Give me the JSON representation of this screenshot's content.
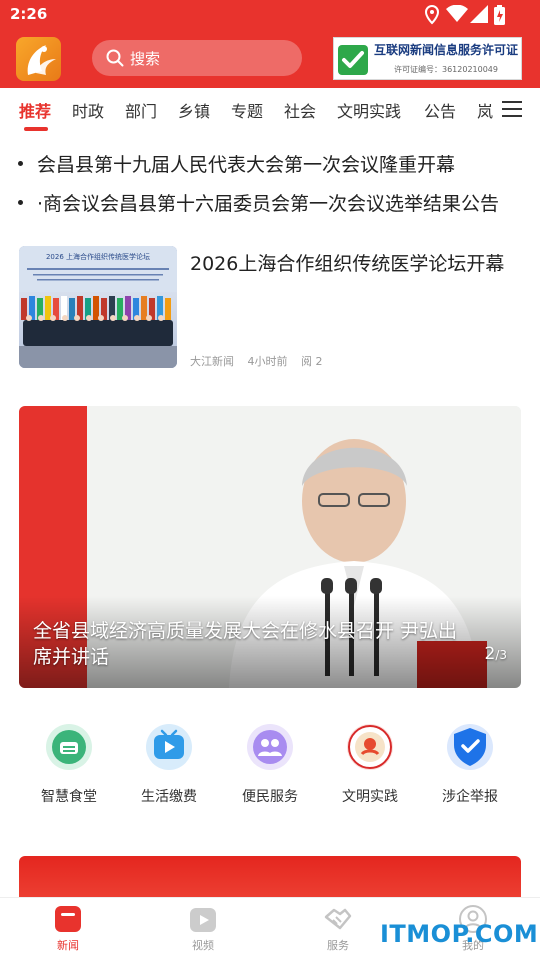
{
  "status_bar": {
    "time": "2:26"
  },
  "header": {
    "search_placeholder": "搜索",
    "license": {
      "title": "互联网新闻信息服务许可证",
      "code": "许可证编号：36120210049"
    }
  },
  "tabs": [
    {
      "label": "推荐",
      "active": true
    },
    {
      "label": "时政"
    },
    {
      "label": "部门"
    },
    {
      "label": "乡镇"
    },
    {
      "label": "专题"
    },
    {
      "label": "社会"
    },
    {
      "label": "文明实践"
    },
    {
      "label": "公告"
    },
    {
      "label": "岚"
    }
  ],
  "headlines": [
    "会昌县第十九届人民代表大会第一次会议隆重开幕",
    "·商会议会昌县第十六届委员会第一次会议选举结果公告"
  ],
  "news_item": {
    "title": "2026上海合作组织传统医学论坛开幕",
    "source": "大江新闻",
    "time": "4小时前",
    "reads": "阅 2",
    "thumb_banner_text": "2026 上海合作组织传统医学论坛"
  },
  "banner": {
    "caption": "全省县域经济高质量发展大会在修水县召开 尹弘出席并讲话",
    "page_current": "2",
    "page_total": "/3"
  },
  "services": [
    {
      "label": "智慧食堂",
      "icon": "canteen-icon",
      "color": "#3bb47a"
    },
    {
      "label": "生活缴费",
      "icon": "tv-payment-icon",
      "color": "#2f9be8"
    },
    {
      "label": "便民服务",
      "icon": "people-service-icon",
      "color": "#8e6ee0"
    },
    {
      "label": "文明实践",
      "icon": "civilization-emblem-icon",
      "color": "#d82a2a"
    },
    {
      "label": "涉企举报",
      "icon": "shield-check-icon",
      "color": "#1e73e8"
    }
  ],
  "bottom_nav": [
    {
      "label": "新闻",
      "active": true
    },
    {
      "label": "视频"
    },
    {
      "label": "服务"
    },
    {
      "label": "我的"
    }
  ],
  "watermark": "ITMOP.COM",
  "colors": {
    "brand_red": "#e8332d",
    "text_dark": "#222222",
    "meta_gray": "#999999"
  }
}
